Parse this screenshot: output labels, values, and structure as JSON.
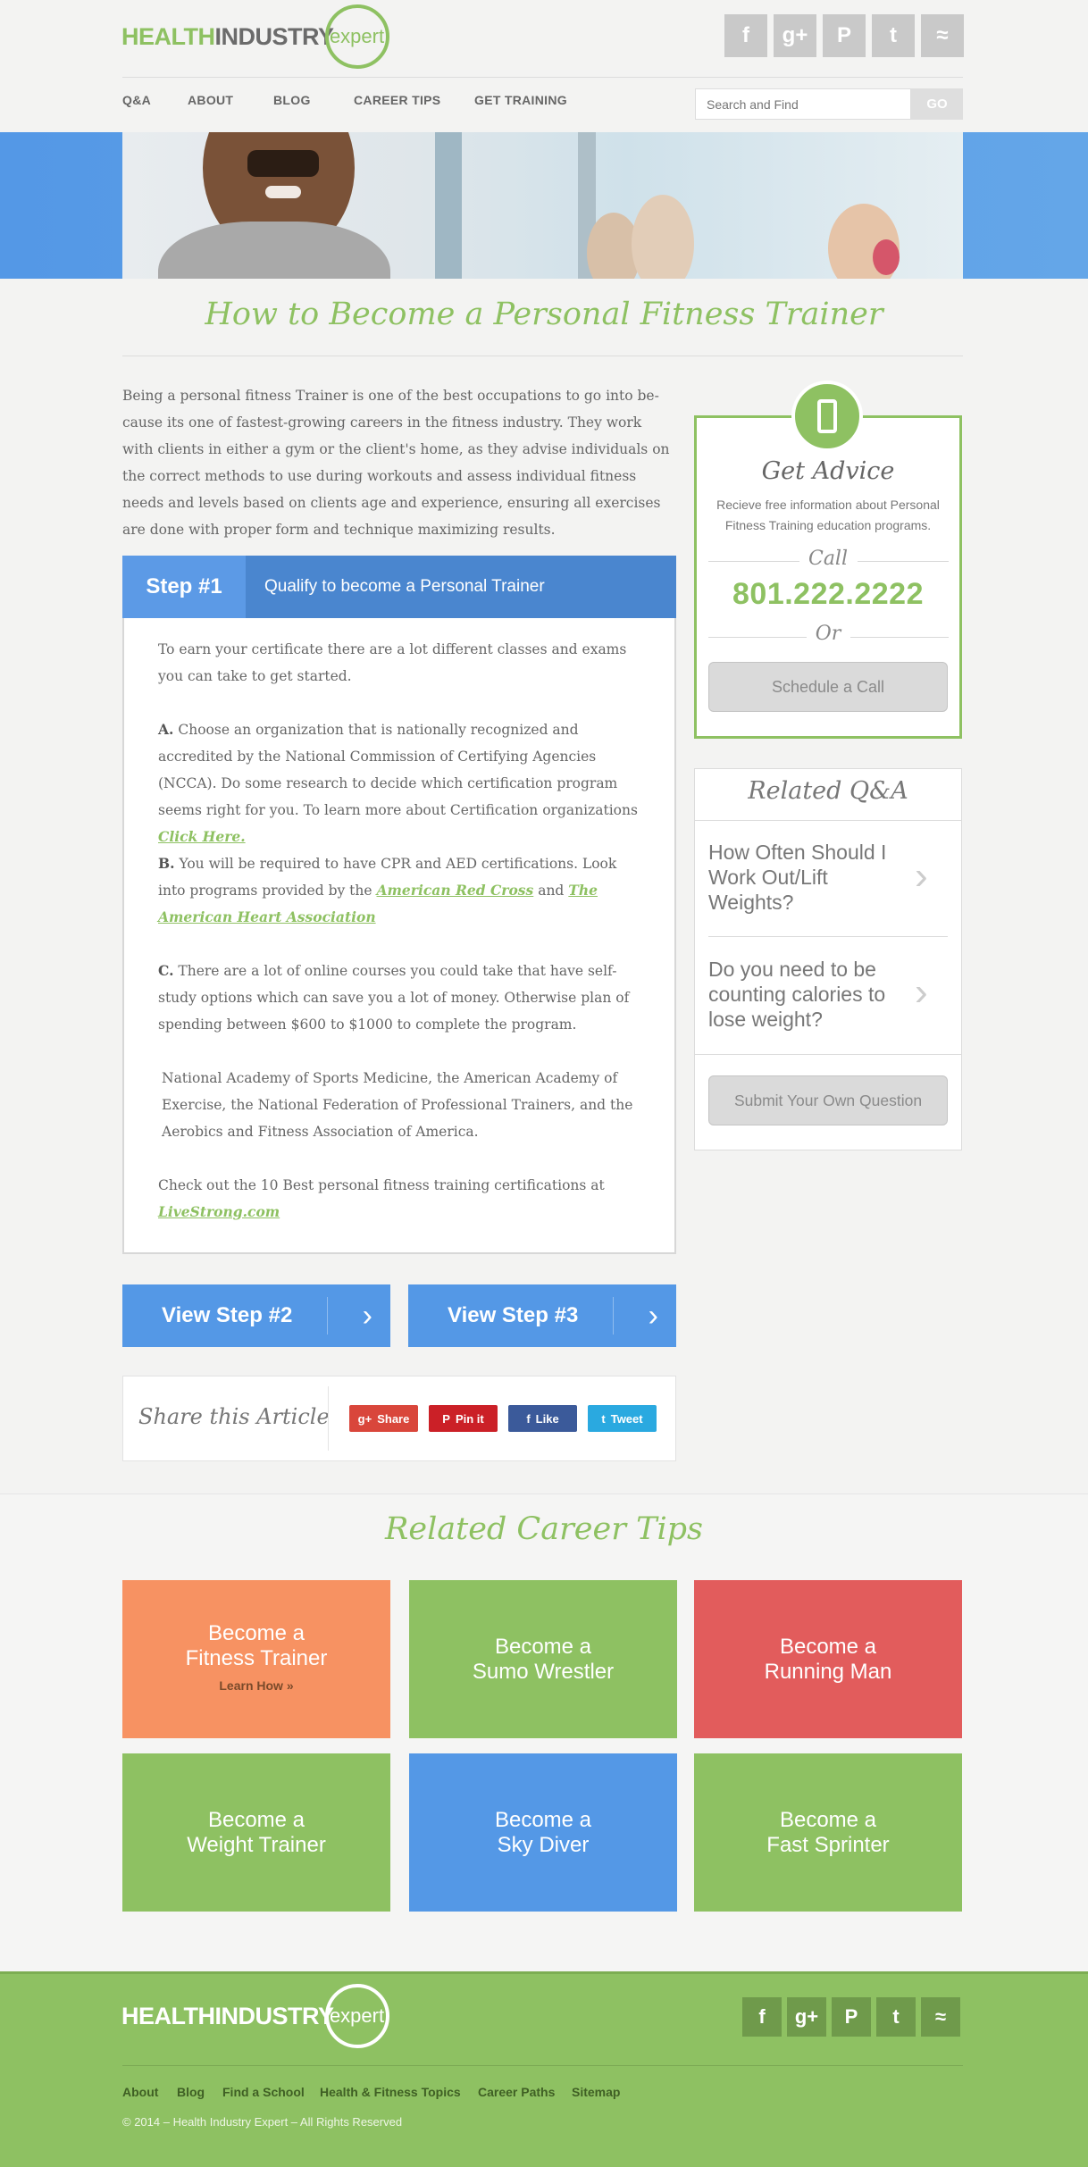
{
  "header": {
    "logo": {
      "health": "HEALTH",
      "industry": "INDUSTRY",
      "expert": "expert"
    },
    "social": [
      {
        "name": "facebook-icon",
        "glyph": "f"
      },
      {
        "name": "google-plus-icon",
        "glyph": "g+"
      },
      {
        "name": "pinterest-icon",
        "glyph": "P"
      },
      {
        "name": "twitter-icon",
        "glyph": "t"
      },
      {
        "name": "rss-icon",
        "glyph": "≈"
      }
    ],
    "nav": [
      "Q&A",
      "ABOUT",
      "BLOG",
      "CAREER TIPS",
      "GET TRAINING"
    ],
    "search_placeholder": "Search and Find",
    "search_button": "GO"
  },
  "article": {
    "title": "How to Become a Personal Fitness Trainer",
    "intro": "Being a personal fitness Trainer is one of the best occupations to go into be-cause its one of fastest-growing careers in the fitness industry. They work with clients in either a gym or the client's home, as they advise individuals on the correct methods to use during workouts and assess individual fitness needs and levels based on clients age and experience, ensuring all exercises are done with proper form and technique maximizing results.",
    "step": {
      "number": "Step #1",
      "title": "Qualify to become a Personal Trainer",
      "p1": "To earn your certificate there are a lot different classes and exams you can take to get started.",
      "a_label": "A.",
      "a_text": "Choose an organization that is nationally recognized and accredited by the National Commission of Certifying Agencies (NCCA). Do some research to decide which certification program seems right for you. To learn more about Certification organizations",
      "a_link": "Click Here.",
      "b_label": "B.",
      "b_text": "You will be required to have CPR and AED certifications. Look into programs provided by the",
      "b_link1": "American Red Cross",
      "b_and": "and",
      "b_link2": "The American Heart Association",
      "c_label": "C.",
      "c_text": "There are a lot of online courses you could take that have self-study options which can save you a lot of money. Otherwise plan of spending between $600 to $1000 to complete the program.",
      "p5": "National Academy of Sports Medicine, the American Academy of Exercise, the National Federation of Professional Trainers, and the Aerobics and Fitness Association of America.",
      "p6": "Check out the 10 Best personal fitness training certifications at",
      "p6_link": "LiveStrong.com"
    },
    "view_step2": "View Step #2",
    "view_step3": "View Step #3",
    "chevron": "›",
    "share": {
      "label": "Share this Article",
      "buttons": [
        {
          "label": "Share",
          "icon": "g+",
          "color": "#d9463b"
        },
        {
          "label": "Pin it",
          "icon": "P",
          "color": "#cb2027"
        },
        {
          "label": "Like",
          "icon": "f",
          "color": "#3b5a9a"
        },
        {
          "label": "Tweet",
          "icon": "t",
          "color": "#2aa9e0"
        }
      ]
    }
  },
  "sidebar": {
    "advice": {
      "title": "Get Advice",
      "text": "Recieve free information about Personal Fitness Training education programs.",
      "call": "Call",
      "phone": "801.222.2222",
      "or": "Or",
      "schedule": "Schedule a Call"
    },
    "qa": {
      "title": "Related Q&A",
      "items": [
        "How Often Should I Work Out/Lift Weights?",
        "Do you need to be counting calories to lose weight?"
      ],
      "submit": "Submit Your Own Question"
    }
  },
  "tips": {
    "title": "Related Career Tips",
    "tiles": [
      {
        "line1": "Become a",
        "line2": "Fitness Trainer",
        "extra": "Learn How »",
        "color": "#f79262"
      },
      {
        "line1": "Become a",
        "line2": "Sumo Wrestler",
        "color": "#8ec162"
      },
      {
        "line1": "Become a",
        "line2": "Running Man",
        "color": "#e25c5c"
      },
      {
        "line1": "Become a",
        "line2": "Weight Trainer",
        "color": "#8ec162"
      },
      {
        "line1": "Become a",
        "line2": "Sky Diver",
        "color": "#5498e6"
      },
      {
        "line1": "Become a",
        "line2": "Fast Sprinter",
        "color": "#8ec162"
      }
    ]
  },
  "footer": {
    "links": [
      "About",
      "Blog",
      "Find a School",
      "Health & Fitness Topics",
      "Career Paths",
      "Sitemap"
    ],
    "copyright": "© 2014 – Health Industry Expert – All Rights Reserved"
  }
}
